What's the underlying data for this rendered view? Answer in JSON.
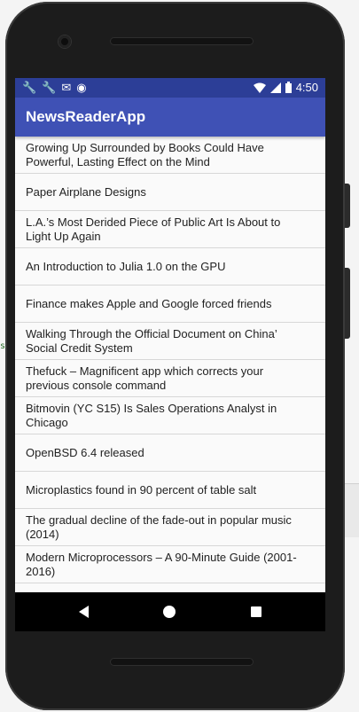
{
  "status_bar": {
    "left_icons": [
      "wrench-icon",
      "wrench-icon",
      "mail-icon",
      "circle-icon"
    ],
    "right_icons": [
      "wifi-icon",
      "signal-icon",
      "battery-icon"
    ],
    "time": "4:50"
  },
  "app_bar": {
    "title": "NewsReaderApp"
  },
  "articles": [
    {
      "title": "Growing Up Surrounded by Books Could Have Powerful, Lasting Effect on the Mind"
    },
    {
      "title": "Paper Airplane Designs"
    },
    {
      "title": "L.A.’s Most Derided Piece of Public Art Is About to Light Up Again"
    },
    {
      "title": "An Introduction to Julia 1.0 on the GPU"
    },
    {
      "title": "Finance makes Apple and Google forced friends"
    },
    {
      "title": "Walking Through the Official Document on China’ Social Credit System"
    },
    {
      "title": "Thefuck – Magnificent app which corrects your previous console command"
    },
    {
      "title": "Bitmovin (YC S15) Is Sales Operations Analyst in Chicago"
    },
    {
      "title": "OpenBSD 6.4 released"
    },
    {
      "title": "Microplastics found in 90 percent of table salt"
    },
    {
      "title": "The gradual decline of the fade-out in popular music (2014)"
    },
    {
      "title": "Modern Microprocessors – A 90-Minute Guide (2001-2016)"
    }
  ],
  "nav_bar": {
    "icons": [
      "back-icon",
      "home-icon",
      "recents-icon"
    ]
  },
  "colors": {
    "status_bar": "#2c3e97",
    "app_bar": "#3f51b5",
    "list_background": "#fafafa",
    "divider": "#d7d7d7"
  }
}
